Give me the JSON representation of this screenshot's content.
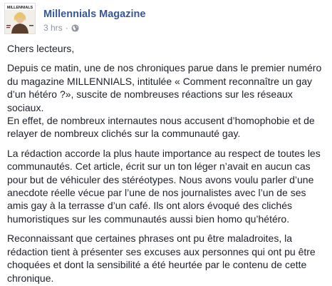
{
  "post": {
    "page_name": "Millennials Magazine",
    "timestamp": "3 hrs",
    "separator": "·",
    "privacy_icon": "globe-icon",
    "avatar_text": "MILLENNIALS",
    "paragraphs": [
      "Chers lecteurs,",
      "Depuis ce matin, une de nos chroniques parue dans le premier numéro du magazine MILLENNIALS, intitulée « Comment reconnaître un gay d’un hétéro ?», suscite de nombreuses réactions sur les réseaux sociaux.",
      "En effet, de nombreux internautes nous accusent d’homophobie et de relayer de nombreux clichés sur la communauté gay.",
      "La rédaction accorde la plus haute importance au respect de toutes les communautés. Cet article, écrit sur un ton léger n’avait en aucun cas pour but de véhiculer des stéréotypes. Nous avons voulu parler d’une anecdote réelle vécue par l’une de nos journalistes avec l’un de ses amis gay à la terrasse d’un café. Ils ont alors évoqué des clichés humoristiques sur les communautés aussi bien homo qu’hétéro.",
      "Reconnaissant que certaines phrases ont pu être maladroites, la rédaction tient à présenter ses excuses aux personnes qui ont pu être choquées et dont la sensibilité a été heurtée par le contenu de cette chronique."
    ]
  },
  "colors": {
    "link": "#365899",
    "text": "#1d2129",
    "meta": "#90949c"
  }
}
